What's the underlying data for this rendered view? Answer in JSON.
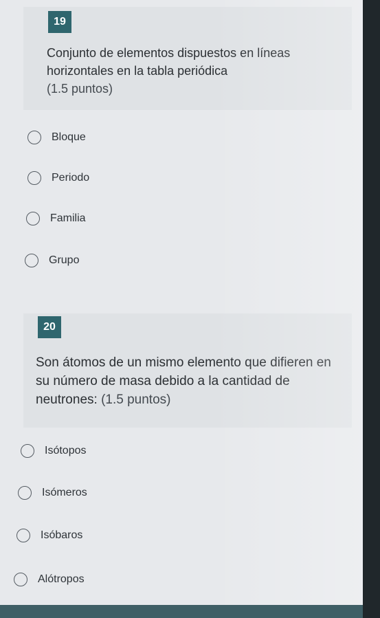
{
  "questions": [
    {
      "number": "19",
      "text": "Conjunto de elementos dispuestos en líneas horizontales en la tabla periódica",
      "points": "(1.5 puntos)",
      "options": [
        "Bloque",
        "Periodo",
        "Familia",
        "Grupo"
      ]
    },
    {
      "number": "20",
      "text": "Son átomos de un mismo elemento que difieren en su número de masa debido a la cantidad de neutrones:",
      "points": "(1.5 puntos)",
      "options": [
        "Isótopos",
        "Isómeros",
        "Isóbaros",
        "Alótropos"
      ]
    }
  ],
  "colors": {
    "number_badge": "#2f666e",
    "background": "#e7e9ec"
  }
}
